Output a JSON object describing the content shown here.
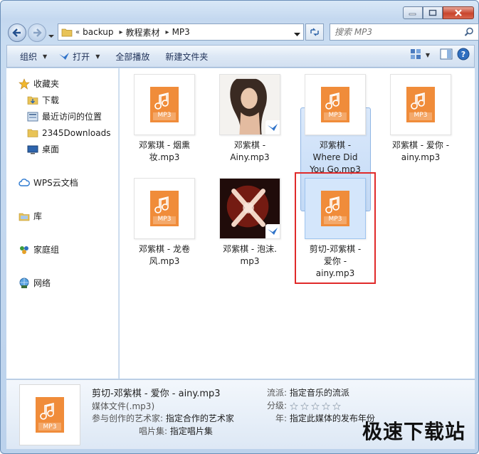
{
  "address": {
    "overflow": "«",
    "crumbs": [
      "backup",
      "教程素材",
      "MP3"
    ]
  },
  "search": {
    "placeholder": "搜索 MP3"
  },
  "toolbar": {
    "organize": "组织",
    "open": "打开",
    "play_all": "全部播放",
    "new_folder": "新建文件夹"
  },
  "sidebar": {
    "favorites": "收藏夹",
    "fav_items": [
      "下载",
      "最近访问的位置",
      "2345Downloads",
      "桌面"
    ],
    "wps": "WPS云文档",
    "library": "库",
    "homegroup": "家庭组",
    "network": "网络"
  },
  "files": [
    {
      "name1": "邓紫琪 - 烟熏",
      "name2": "妆.mp3",
      "name3": ""
    },
    {
      "name1": "邓紫棋 -",
      "name2": "Ainy.mp3",
      "name3": ""
    },
    {
      "name1": "邓紫棋 -",
      "name2": "Where Did",
      "name3": "You Go.mp3"
    },
    {
      "name1": "邓紫棋 - 爱你 -",
      "name2": "ainy.mp3",
      "name3": ""
    },
    {
      "name1": "邓紫棋 - 龙卷",
      "name2": "风.mp3",
      "name3": ""
    },
    {
      "name1": "邓紫棋 - 泡沫.",
      "name2": "mp3",
      "name3": ""
    },
    {
      "name1": "剪切-邓紫棋 -",
      "name2": "爱你 -",
      "name3": "ainy.mp3"
    }
  ],
  "file_label": "MP3",
  "details": {
    "title": "剪切-邓紫棋 - 爱你 - ainy.mp3",
    "type": "媒体文件(.mp3)",
    "artist_k": "参与创作的艺术家:",
    "artist_v": "指定合作的艺术家",
    "album_k": "唱片集:",
    "album_v": "指定唱片集",
    "genre_k": "流派:",
    "genre_v": "指定音乐的流派",
    "rating_k": "分级:",
    "year_k": "年:",
    "year_v": "指定此媒体的发布年份"
  },
  "watermark": "极速下载站",
  "colors": {
    "accent": "#f08c3a",
    "selection": "#cfe2f8",
    "highlight": "#e02a2a"
  }
}
